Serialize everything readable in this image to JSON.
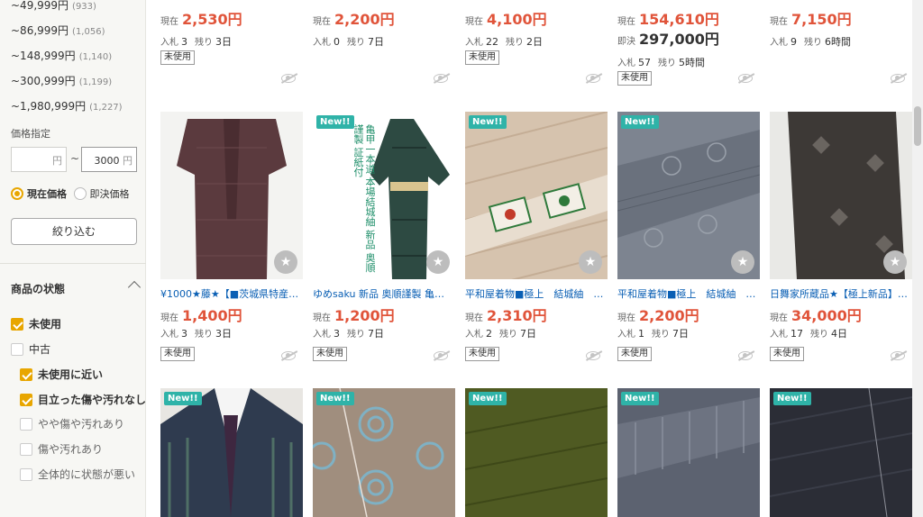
{
  "sidebar": {
    "price_ranges": [
      {
        "label": "~49,999円",
        "count": "(933)"
      },
      {
        "label": "~86,999円",
        "count": "(1,056)"
      },
      {
        "label": "~148,999円",
        "count": "(1,140)"
      },
      {
        "label": "~300,999円",
        "count": "(1,199)"
      },
      {
        "label": "~1,980,999円",
        "count": "(1,227)"
      }
    ],
    "price_spec_label": "価格指定",
    "min_placeholder": "円",
    "max_value": "3000",
    "yen": "円",
    "tilde": "~",
    "radio_current": "現在価格",
    "radio_buyout": "即決価格",
    "filter_button": "絞り込む",
    "condition_header": "商品の状態",
    "conditions": [
      {
        "label": "未使用",
        "checked": true
      },
      {
        "label": "中古",
        "checked": false
      },
      {
        "label": "未使用に近い",
        "checked": true
      },
      {
        "label": "目立った傷や汚れなし",
        "checked": true
      },
      {
        "label": "やや傷や汚れあり",
        "checked": false
      },
      {
        "label": "傷や汚れあり",
        "checked": false
      },
      {
        "label": "全体的に状態が悪い",
        "checked": false
      }
    ]
  },
  "labels": {
    "current": "現在",
    "buyout": "即決",
    "bids": "入札",
    "remaining": "残り",
    "unused": "未使用",
    "new": "New!!",
    "star": "★"
  },
  "top_row": [
    {
      "price": "2,530円",
      "bids": "3",
      "remaining": "3日",
      "badge": "未使用"
    },
    {
      "price": "2,200円",
      "bids": "0",
      "remaining": "7日",
      "badge": ""
    },
    {
      "price": "4,100円",
      "bids": "22",
      "remaining": "2日",
      "badge": "未使用"
    },
    {
      "price": "154,610円",
      "buyout": "297,000円",
      "bids": "57",
      "remaining": "5時間",
      "badge": "未使用"
    },
    {
      "price": "7,150円",
      "bids": "9",
      "remaining": "6時間",
      "badge": ""
    }
  ],
  "mid_row": [
    {
      "title": "¥1000★藤★【■茨城県特産■…",
      "price": "1,400円",
      "bids": "3",
      "remaining": "3日",
      "badge": "未使用",
      "new": false
    },
    {
      "title": "ゆめsaku 新品 奥順謹製 亀甲一…",
      "price": "1,200円",
      "bids": "3",
      "remaining": "7日",
      "badge": "未使用",
      "new": true,
      "image_text": [
        "亀甲一本道",
        "本場結城紬",
        "新品",
        "奥順謹製",
        "証紙付"
      ]
    },
    {
      "title": "平和屋着物■極上　結城紬　奥…",
      "price": "2,310円",
      "bids": "2",
      "remaining": "7日",
      "badge": "未使用",
      "new": true
    },
    {
      "title": "平和屋着物■極上　結城紬　奥…",
      "price": "2,200円",
      "bids": "1",
      "remaining": "7日",
      "badge": "未使用",
      "new": true
    },
    {
      "title": "日舞家所蔵品★【極上新品】京…",
      "price": "34,000円",
      "bids": "17",
      "remaining": "4日",
      "badge": "未使用",
      "new": false
    }
  ],
  "bottom_row": [
    {
      "new": true
    },
    {
      "new": true
    },
    {
      "new": true
    },
    {
      "new": true
    },
    {
      "new": true
    }
  ]
}
